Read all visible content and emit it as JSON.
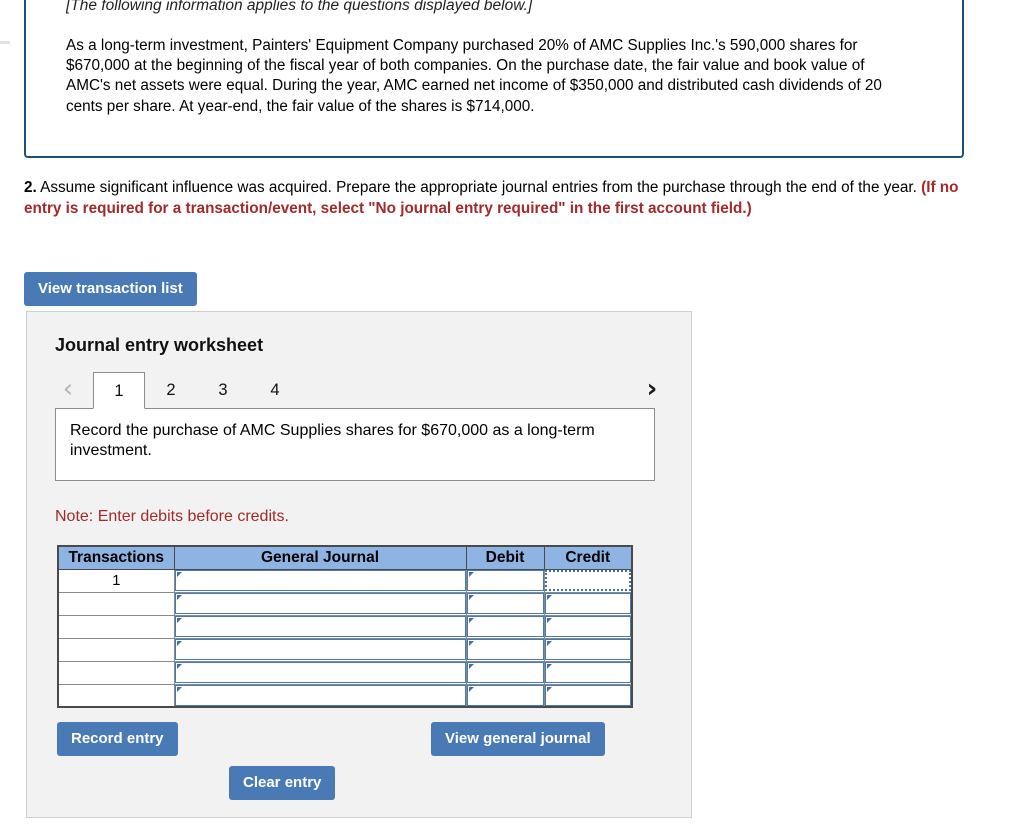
{
  "question_box": {
    "header_note": "[The following information applies to the questions displayed below.]",
    "body": "As a long-term investment, Painters' Equipment Company purchased 20% of AMC Supplies Inc.'s 590,000 shares for $670,000 at the beginning of the fiscal year of both companies. On the purchase date, the fair value and book value of AMC's net assets were equal. During the year, AMC earned net income of $350,000 and distributed cash dividends of 20 cents per share. At year-end, the fair value of the shares is $714,000."
  },
  "requirement": {
    "number": "2.",
    "text": " Assume significant influence was acquired. Prepare the appropriate journal entries from the purchase through the end of the year. ",
    "red_text": "(If no entry is required for a transaction/event, select \"No journal entry required\" in the first account field.)"
  },
  "buttons": {
    "view_transaction_list": "View transaction list",
    "record_entry": "Record entry",
    "clear_entry": "Clear entry",
    "view_general_journal": "View general journal"
  },
  "worksheet": {
    "title": "Journal entry worksheet",
    "prev_icon": "chevron-left",
    "next_icon": "chevron-right",
    "tabs": [
      {
        "label": "1",
        "active": true
      },
      {
        "label": "2",
        "active": false
      },
      {
        "label": "3",
        "active": false
      },
      {
        "label": "4",
        "active": false
      }
    ],
    "active_tab_description": "Record the purchase of AMC Supplies shares for $670,000 as a long-term investment.",
    "note": "Note: Enter debits before credits."
  },
  "journal_table": {
    "headers": [
      "Transactions",
      "General Journal",
      "Debit",
      "Credit"
    ],
    "rows": [
      {
        "transaction": "1",
        "general_journal": "",
        "debit": "",
        "credit": "",
        "credit_focused": true
      },
      {
        "transaction": "",
        "general_journal": "",
        "debit": "",
        "credit": "",
        "credit_focused": false
      },
      {
        "transaction": "",
        "general_journal": "",
        "debit": "",
        "credit": "",
        "credit_focused": false
      },
      {
        "transaction": "",
        "general_journal": "",
        "debit": "",
        "credit": "",
        "credit_focused": false
      },
      {
        "transaction": "",
        "general_journal": "",
        "debit": "",
        "credit": "",
        "credit_focused": false
      },
      {
        "transaction": "",
        "general_journal": "",
        "debit": "",
        "credit": "",
        "credit_focused": false
      }
    ]
  },
  "colors": {
    "question_box_border": "#1f4e79",
    "button_blue": "#4a7ab5",
    "table_header_blue": "#8db4e2",
    "red_text": "#a32a2a",
    "panel_background": "#f2f2f2"
  }
}
